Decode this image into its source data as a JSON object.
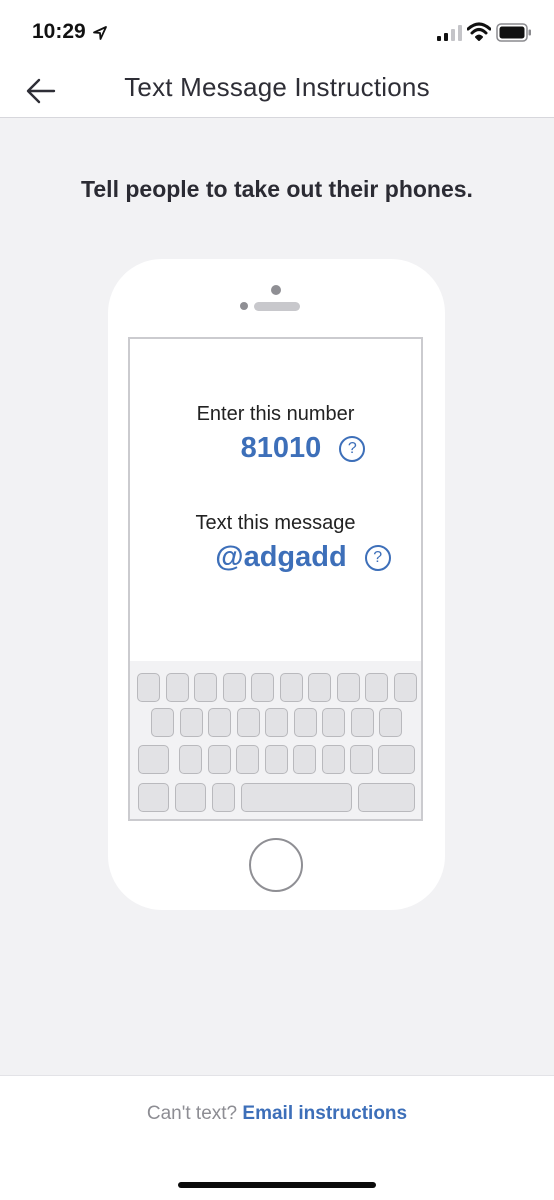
{
  "status_bar": {
    "time": "10:29",
    "icons": [
      "location-arrow-icon",
      "signal-icon",
      "wifi-icon",
      "battery-icon"
    ]
  },
  "nav": {
    "back_icon": "arrow-left-icon",
    "title": "Text Message Instructions"
  },
  "heading": "Tell people to take out their phones.",
  "phone": {
    "number_label": "Enter this number",
    "number_value": "81010",
    "message_label": "Text this message",
    "message_value": "@adgadd",
    "help_symbol": "?"
  },
  "footer": {
    "cant_text": "Can't text?",
    "email_link": "Email instructions"
  },
  "colors": {
    "accent": "#3d6fb9",
    "background": "#f2f2f4",
    "text": "#2b2b33"
  }
}
